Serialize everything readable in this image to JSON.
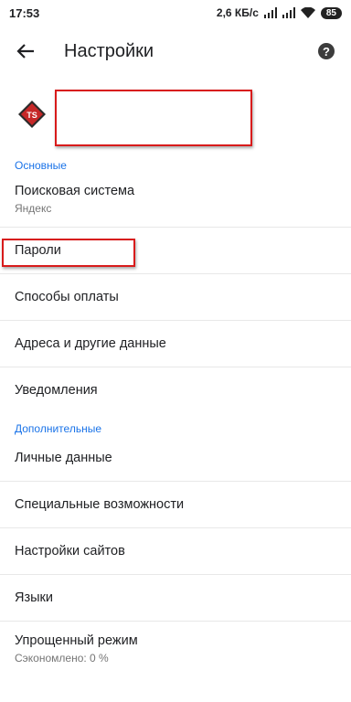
{
  "status_bar": {
    "time": "17:53",
    "net_speed": "2,6 КБ/с",
    "battery": "85"
  },
  "toolbar": {
    "title": "Настройки",
    "back_icon": "arrow-left-icon",
    "help_icon": "help-icon",
    "help_glyph": "?"
  },
  "account": {
    "avatar_text": "TS",
    "avatar_color": "#c62828"
  },
  "sections": {
    "basic": {
      "header": "Основные",
      "items": [
        {
          "label": "Поисковая система",
          "sub": "Яндекс"
        },
        {
          "label": "Пароли"
        },
        {
          "label": "Способы оплаты"
        },
        {
          "label": "Адреса и другие данные"
        },
        {
          "label": "Уведомления"
        }
      ]
    },
    "advanced": {
      "header": "Дополнительные",
      "items": [
        {
          "label": "Личные данные"
        },
        {
          "label": "Специальные возможности"
        },
        {
          "label": "Настройки сайтов"
        },
        {
          "label": "Языки"
        },
        {
          "label": "Упрощенный режим",
          "sub": "Сэкономлено: 0 %"
        }
      ]
    }
  },
  "colors": {
    "accent": "#1a73e8",
    "highlight": "#d81b1b"
  }
}
